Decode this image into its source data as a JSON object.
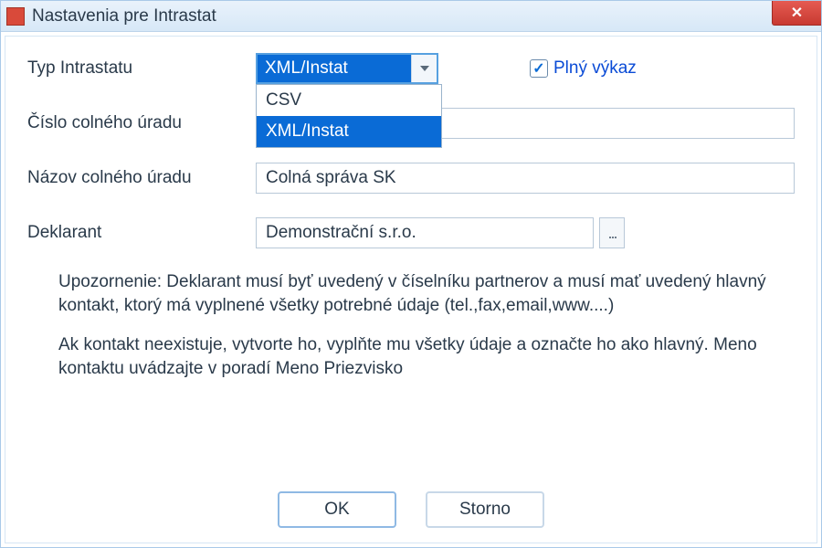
{
  "window": {
    "title": "Nastavenia pre Intrastat"
  },
  "labels": {
    "type": "Typ Intrastatu",
    "office_no": "Číslo colného úradu",
    "office_name": "Názov colného úradu",
    "declarant": "Deklarant"
  },
  "fields": {
    "type_selected": "XML/Instat",
    "type_options": [
      "CSV",
      "XML/Instat"
    ],
    "full_report_checked": true,
    "full_report_label": "Plný výkaz",
    "office_no_value": "",
    "office_name_value": "Colná správa SK",
    "declarant_value": "Demonstrační s.r.o."
  },
  "notice": {
    "p1": "Upozornenie: Deklarant musí byť uvedený v číselníku partnerov a musí mať uvedený hlavný kontakt, ktorý má vyplnené všetky potrebné údaje (tel.,fax,email,www....)",
    "p2": "Ak kontakt neexistuje, vytvorte ho, vyplňte mu všetky údaje a označte ho ako hlavný. Meno kontaktu uvádzajte v poradí Meno Priezvisko"
  },
  "buttons": {
    "ok": "OK",
    "cancel": "Storno",
    "picker": "..."
  },
  "icons": {
    "checkmark": "✓"
  }
}
